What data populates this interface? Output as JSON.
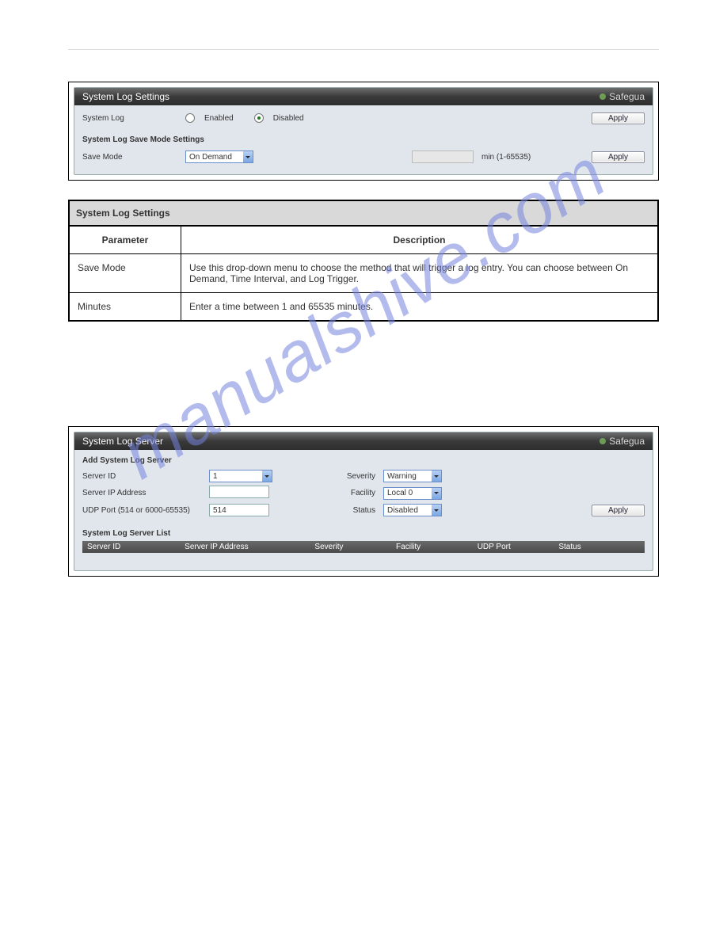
{
  "watermark": "manualshive.com",
  "figure1": {
    "title": "System Log Settings",
    "safeguard": "Safegua",
    "row_label": "System Log",
    "enabled": "Enabled",
    "disabled": "Disabled",
    "apply": "Apply",
    "section2_title": "System Log Save Mode Settings",
    "save_mode_label": "Save Mode",
    "save_mode_value": "On Demand",
    "min_hint": "min (1-65535)"
  },
  "table1": {
    "header": "System Log Settings",
    "col_param": "Parameter",
    "col_desc": "Description",
    "rows": [
      {
        "param": "Save Mode",
        "desc": "Use this drop-down menu to choose the method that will trigger a log entry. You can choose between On Demand, Time Interval, and Log Trigger."
      },
      {
        "param": "Minutes",
        "desc": "Enter a time between 1 and 65535 minutes."
      }
    ]
  },
  "figure2": {
    "title": "System Log Server",
    "safeguard": "Safegua",
    "add_title": "Add System Log Server",
    "server_id_label": "Server ID",
    "server_id_value": "1",
    "severity_label": "Severity",
    "severity_value": "Warning",
    "server_ip_label": "Server IP Address",
    "facility_label": "Facility",
    "facility_value": "Local 0",
    "udp_label": "UDP Port  (514 or 6000-65535)",
    "udp_value": "514",
    "status_label": "Status",
    "status_value": "Disabled",
    "apply": "Apply",
    "list_title": "System Log Server List",
    "cols": [
      "Server ID",
      "Server IP Address",
      "Severity",
      "Facility",
      "UDP Port",
      "Status"
    ]
  }
}
